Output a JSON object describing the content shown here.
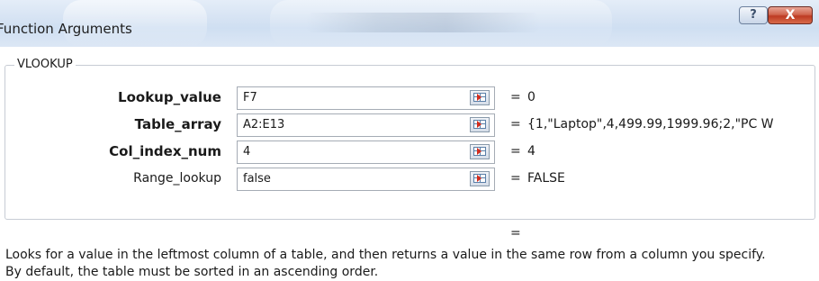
{
  "window": {
    "title": "Function Arguments",
    "help_label": "?",
    "close_label": "X"
  },
  "function_group": {
    "name": "VLOOKUP"
  },
  "arguments": [
    {
      "label": "Lookup_value",
      "value": "F7",
      "result": "0",
      "required": true
    },
    {
      "label": "Table_array",
      "value": "A2:E13",
      "result": "{1,\"Laptop\",4,499.99,1999.96;2,\"PC W",
      "required": true
    },
    {
      "label": "Col_index_num",
      "value": "4",
      "result": "4",
      "required": true
    },
    {
      "label": "Range_lookup",
      "value": "false",
      "result": "FALSE",
      "required": false
    }
  ],
  "equals_sign": "=",
  "formula_result": {
    "sign": "=",
    "value": ""
  },
  "description": {
    "line1": "Looks for a value in the leftmost column of a table, and then returns a value in the same row from a column you specify.",
    "line2": "By default, the table must be sorted in an ascending order."
  },
  "icons": {
    "collapse_dialog": "range-selector-icon",
    "help": "question-icon",
    "close": "close-icon"
  },
  "colors": {
    "titlebar": "#d6e3f3",
    "close_button": "#c84a32",
    "input_border": "#a5acb5",
    "group_border": "#c7ccd4"
  }
}
